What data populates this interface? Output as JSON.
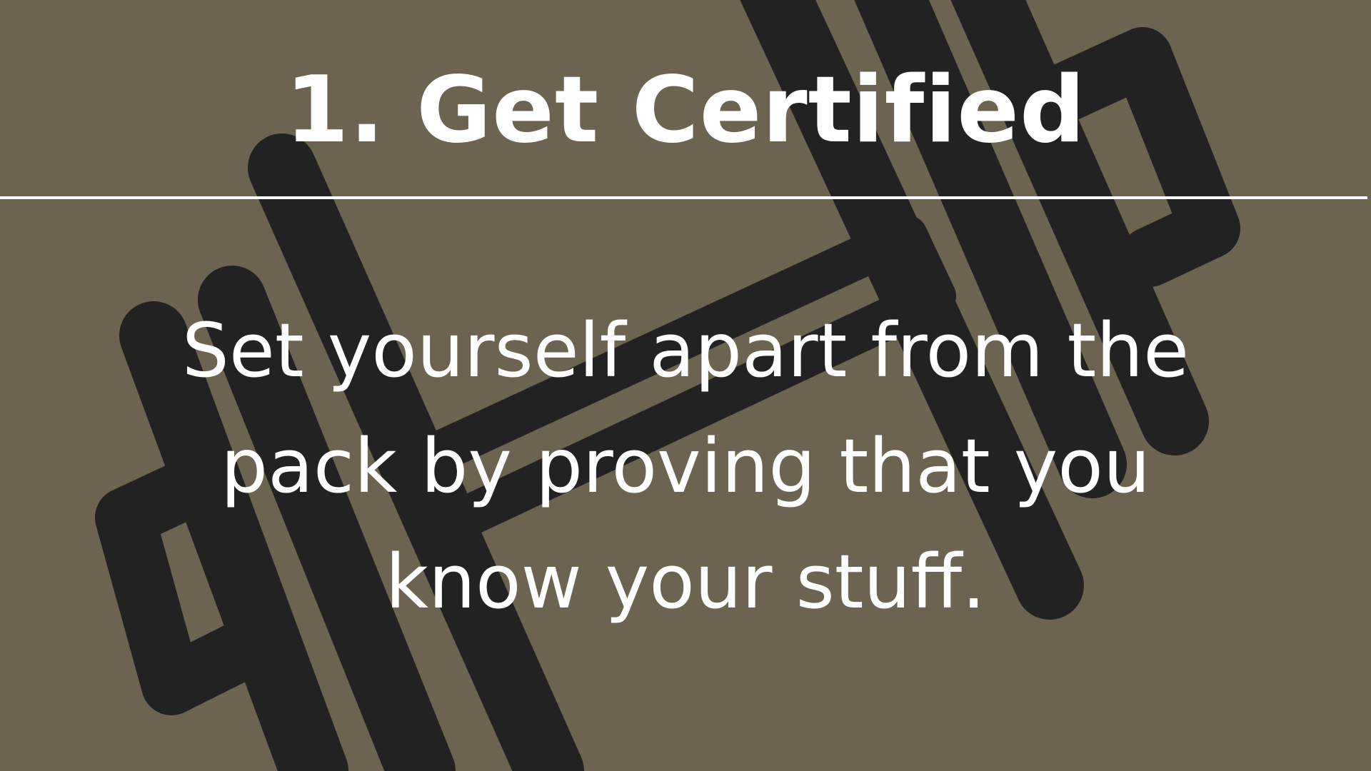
{
  "slide": {
    "heading_number": "1.",
    "heading_title": "Get Certified",
    "body_text": "Set yourself apart from the pack by proving that you know your stuff."
  },
  "colors": {
    "background": "#6c6350",
    "graphic": "#222222",
    "text": "#ffffff",
    "divider": "#ffffff"
  },
  "background_graphic": {
    "icon": "dumbbell-icon"
  }
}
